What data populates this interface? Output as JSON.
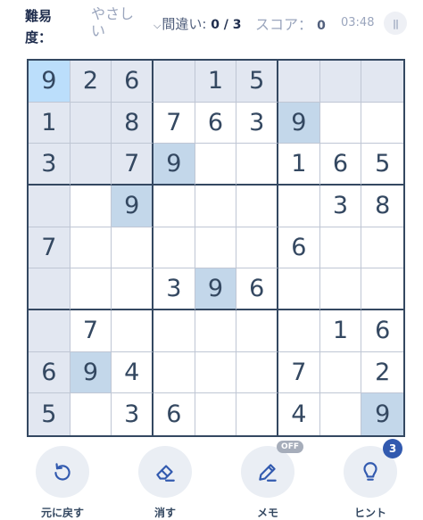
{
  "header": {
    "difficulty_label": "難易度：",
    "difficulty_value": "やさしい",
    "mistakes_label": "間違い:",
    "mistakes_value": "0 / 3",
    "score_label": "スコア：",
    "score_value": "0",
    "timer": "03:48"
  },
  "board": {
    "cells": [
      [
        "9",
        "2",
        "6",
        "",
        "1",
        "5",
        "",
        "",
        ""
      ],
      [
        "1",
        "",
        "8",
        "7",
        "6",
        "3",
        "9",
        "",
        ""
      ],
      [
        "3",
        "",
        "7",
        "9",
        "",
        "",
        "1",
        "6",
        "5"
      ],
      [
        "",
        "",
        "9",
        "",
        "",
        "",
        "",
        "3",
        "8"
      ],
      [
        "7",
        "",
        "",
        "",
        "",
        "",
        "6",
        "",
        ""
      ],
      [
        "",
        "",
        "",
        "3",
        "9",
        "6",
        "",
        "",
        ""
      ],
      [
        "",
        "7",
        "",
        "",
        "",
        "",
        "",
        "1",
        "6"
      ],
      [
        "6",
        "9",
        "4",
        "",
        "",
        "",
        "7",
        "",
        "2"
      ],
      [
        "5",
        "",
        "3",
        "6",
        "",
        "",
        "4",
        "",
        "9"
      ]
    ],
    "selected": [
      0,
      0
    ],
    "highlight_color": "#e2e7f1",
    "same_number_color": "#c3d7ea",
    "selected_color": "#bbdefb"
  },
  "toolbar": {
    "undo_label": "元に戻す",
    "erase_label": "消す",
    "notes_label": "メモ",
    "notes_badge": "OFF",
    "hint_label": "ヒント",
    "hint_count": "3",
    "accent_color": "#325aaf"
  }
}
